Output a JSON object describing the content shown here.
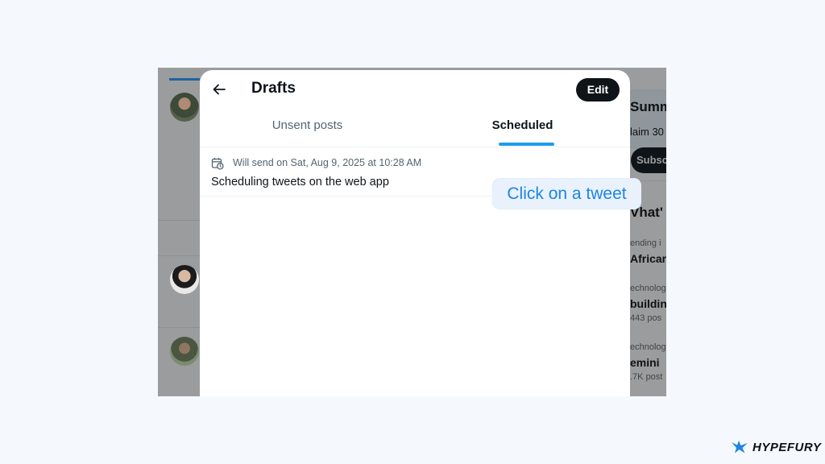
{
  "modal": {
    "title": "Drafts",
    "edit_label": "Edit",
    "tabs": [
      {
        "label": "Unsent posts",
        "active": false
      },
      {
        "label": "Scheduled",
        "active": true
      }
    ],
    "scheduled_items": [
      {
        "send_info": "Will send on Sat, Aug 9, 2025 at 10:28 AM",
        "text": "Scheduling tweets on the web app"
      }
    ]
  },
  "background_sidebar": {
    "card_title": "Summ",
    "card_text": "laim 30",
    "subscribe_label": "Subsc",
    "section_title": "Vhat'",
    "trends": [
      {
        "category": "ending i",
        "name": "Africar",
        "count": ""
      },
      {
        "category": "echnolog",
        "name": "buildin",
        "count": "443 pos"
      },
      {
        "category": "echnolog",
        "name": "emini",
        "count": ".7K post"
      }
    ]
  },
  "callout": {
    "text": "Click on a tweet"
  },
  "brand": {
    "name": "HYPEFURY"
  },
  "colors": {
    "accent": "#1d9bf0",
    "callout_text": "#1d84e6",
    "button_dark": "#0f1419"
  },
  "icons": {
    "back": "arrow-left-icon",
    "schedule": "calendar-clock-icon",
    "brand": "hypefury-logo-icon"
  }
}
